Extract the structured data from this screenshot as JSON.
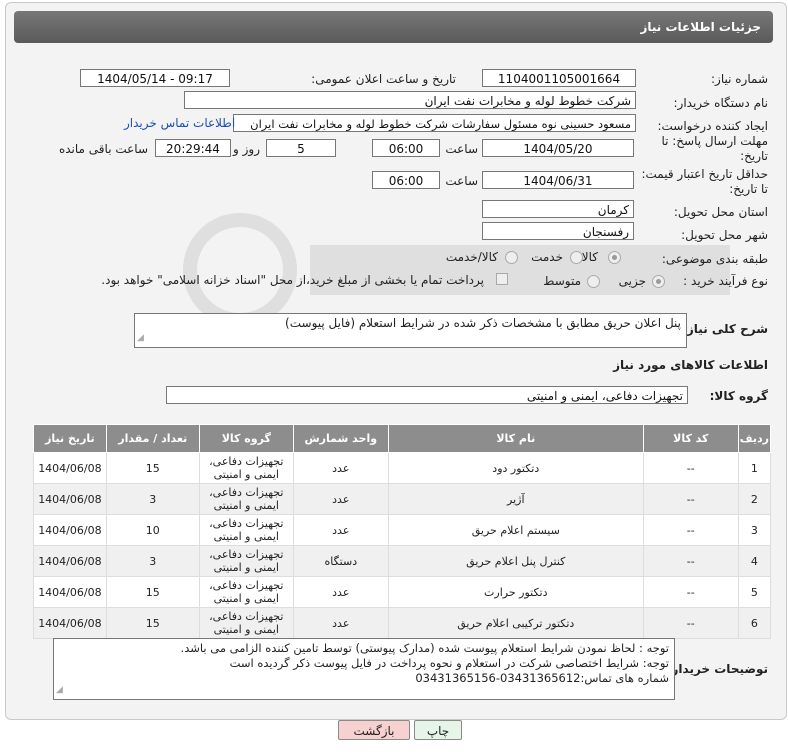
{
  "header": {
    "title": "جزئیات اطلاعات نیاز"
  },
  "form": {
    "need_number_label": "شماره نیاز:",
    "need_number": "1104001105001664",
    "announce_label": "تاریخ و ساعت اعلان عمومی:",
    "announce_value": "1404/05/14 - 09:17",
    "buyer_label": "نام دستگاه خریدار:",
    "buyer_value": "شرکت خطوط لوله و مخابرات نفت ایران",
    "creator_label": "ایجاد کننده درخواست:",
    "creator_value": "مسعود حسینی نوه  مسئول سفارشات  شرکت خطوط لوله و مخابرات نفت ایران",
    "buyer_contact_link": "اطلاعات تماس خریدار",
    "deadline_label": "مهلت ارسال پاسخ: تا تاریخ:",
    "deadline_date": "1404/05/20",
    "time_label": "ساعت",
    "deadline_time": "06:00",
    "days_value": "5",
    "days_label": "روز و",
    "remaining_value": "20:29:44",
    "remaining_label": "ساعت باقی مانده",
    "validity_label": "حداقل تاریخ اعتبار قیمت: تا تاریخ:",
    "validity_date": "1404/06/31",
    "validity_time": "06:00",
    "province_label": "استان محل تحویل:",
    "province_value": "کرمان",
    "city_label": "شهر محل تحویل:",
    "city_value": "رفسنجان",
    "category_label": "طبقه بندی موضوعی:",
    "category_options": [
      "کالا",
      "خدمت",
      "کالا/خدمت"
    ],
    "category_selected": "کالا",
    "process_label": "نوع فرآیند خرید :",
    "process_options": [
      "جزیی",
      "متوسط"
    ],
    "process_selected": "جزیی",
    "payment_text": "پرداخت تمام یا بخشی از مبلغ خرید،از محل \"اسناد خزانه اسلامی\" خواهد بود."
  },
  "description": {
    "label": "شرح کلی نیاز:",
    "value": "پنل اعلان حریق مطابق با مشخصات ذکر شده در شرایط استعلام (فایل پیوست)"
  },
  "goods": {
    "section_title": "اطلاعات کالاهای مورد نیاز",
    "group_label": "گروه کالا:",
    "group_value": "تجهیزات دفاعی، ایمنی و امنیتی",
    "columns": [
      "ردیف",
      "کد کالا",
      "نام کالا",
      "واحد شمارش",
      "گروه کالا",
      "تعداد / مقدار",
      "تاریخ نیاز"
    ],
    "rows": [
      [
        "1",
        "--",
        "دتکتور دود",
        "عدد",
        "تجهیزات دفاعی، ایمنی و امنیتی",
        "15",
        "1404/06/08"
      ],
      [
        "2",
        "--",
        "آژیر",
        "عدد",
        "تجهیزات دفاعی، ایمنی و امنیتی",
        "3",
        "1404/06/08"
      ],
      [
        "3",
        "--",
        "سیستم اعلام حریق",
        "عدد",
        "تجهیزات دفاعی، ایمنی و امنیتی",
        "10",
        "1404/06/08"
      ],
      [
        "4",
        "--",
        "کنترل پنل اعلام حریق",
        "دستگاه",
        "تجهیزات دفاعی، ایمنی و امنیتی",
        "3",
        "1404/06/08"
      ],
      [
        "5",
        "--",
        "دتکتور حرارت",
        "عدد",
        "تجهیزات دفاعی، ایمنی و امنیتی",
        "15",
        "1404/06/08"
      ],
      [
        "6",
        "--",
        "دتکتور ترکیبی اعلام حریق",
        "عدد",
        "تجهیزات دفاعی، ایمنی و امنیتی",
        "15",
        "1404/06/08"
      ]
    ]
  },
  "notes": {
    "label": "توضیحات خریدار:",
    "lines": [
      "توجه : لحاظ نمودن شرایط استعلام پیوست شده (مدارک پیوستی) توسط تامین کننده الزامی می باشد.",
      "توجه: شرایط اختصاصی شرکت در استعلام و نحوه پرداخت در فایل پیوست ذکر گردیده است",
      "شماره های تماس:03431365612-03431365156"
    ]
  },
  "buttons": {
    "print": "چاپ",
    "back": "بازگشت"
  },
  "colors": {
    "header_bg": "#666666",
    "table_header_bg": "#8d8d8d",
    "back_button_bg": "#f7d0d0",
    "print_button_bg": "#e6f5e6"
  }
}
